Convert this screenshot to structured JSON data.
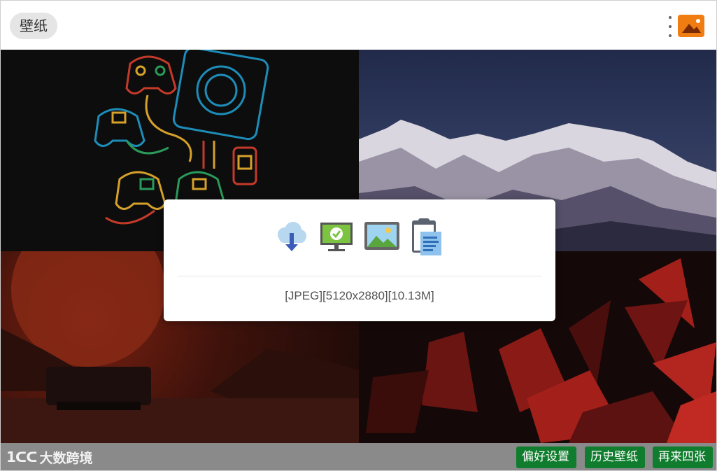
{
  "window": {
    "title": "壁纸"
  },
  "header": {
    "menu_icon": "kebab-menu-icon",
    "app_icon": "image-app-icon",
    "app_icon_color": "#f07d12"
  },
  "wallpapers": [
    {
      "name": "neon-game-controllers"
    },
    {
      "name": "snowy-mountain-dusk"
    },
    {
      "name": "red-planet-rover"
    },
    {
      "name": "red-low-poly"
    }
  ],
  "dialog": {
    "actions": [
      {
        "icon": "cloud-download-icon",
        "label": ""
      },
      {
        "icon": "set-desktop-icon",
        "label": ""
      },
      {
        "icon": "image-icon",
        "label": ""
      },
      {
        "icon": "clipboard-icon",
        "label": ""
      }
    ],
    "info": "[JPEG][5120x2880][10.13M]"
  },
  "footer": {
    "logo_mark": "1ᑕᑕ",
    "logo_text": "大数跨境",
    "buttons": {
      "preferences": "偏好设置",
      "history": "历史壁纸",
      "refresh": "再来四张"
    },
    "button_color": "#0f7d2d"
  }
}
